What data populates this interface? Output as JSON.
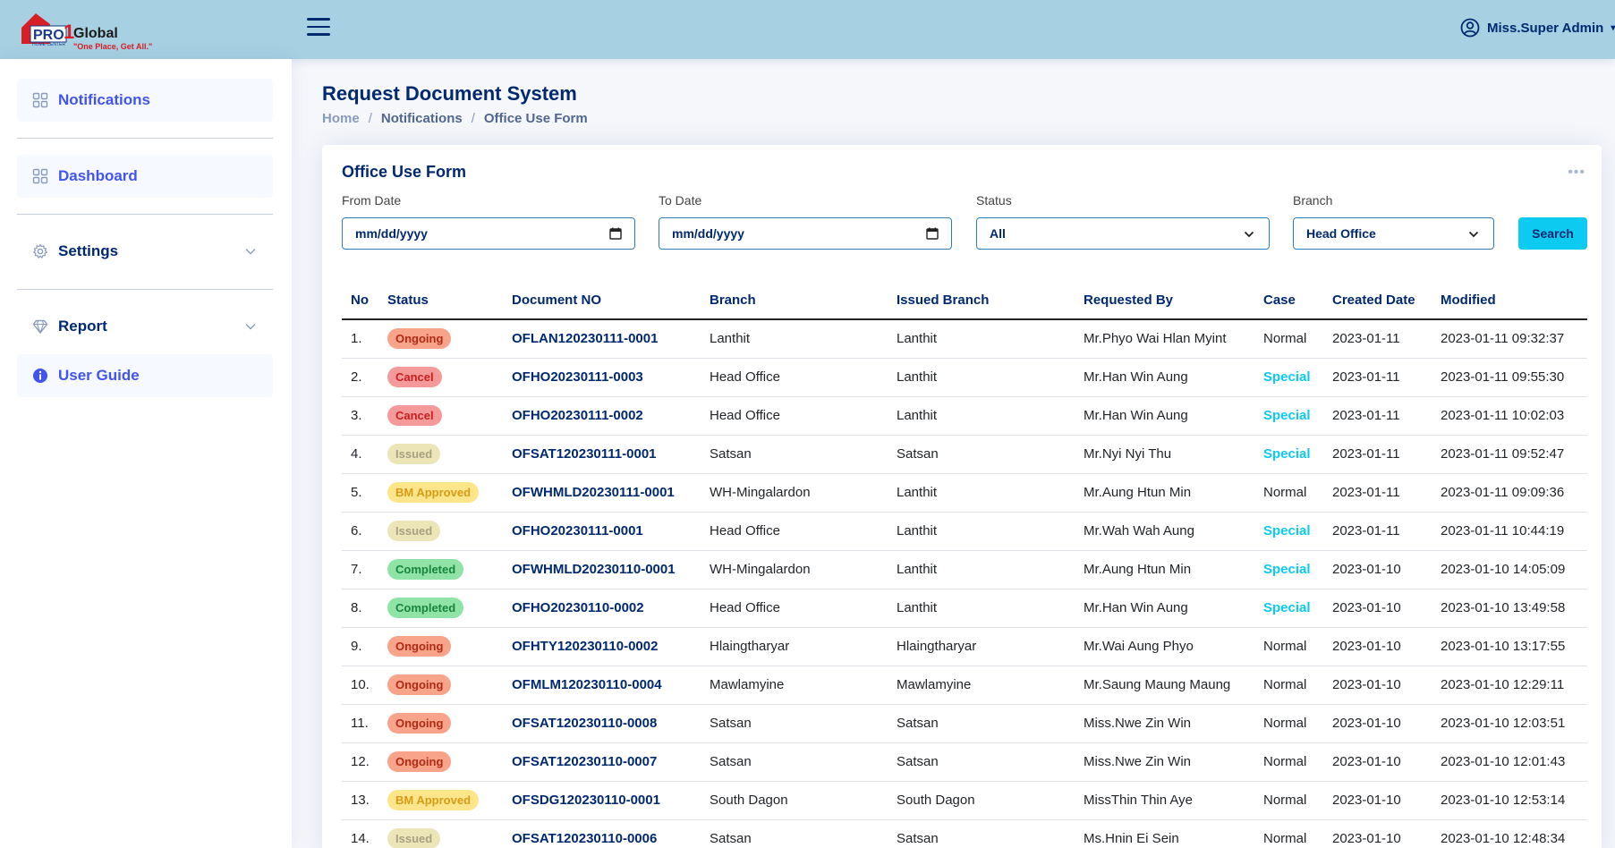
{
  "header": {
    "logo_text": "PRO1 Global",
    "logo_tagline": "\"One Place, Get All.\"",
    "logo_sub": "HOME CENTER",
    "user_name": "Miss.Super Admin"
  },
  "sidebar": {
    "items": [
      {
        "label": "Notifications",
        "icon": "grid-icon"
      },
      {
        "label": "Dashboard",
        "icon": "grid-icon"
      },
      {
        "label": "Settings",
        "icon": "gear-icon"
      },
      {
        "label": "Report",
        "icon": "gem-icon"
      },
      {
        "label": "User Guide",
        "icon": "info-icon"
      }
    ]
  },
  "page": {
    "title": "Request Document System",
    "breadcrumb": [
      "Home",
      "Notifications",
      "Office Use Form"
    ],
    "breadcrumb_sep": "/"
  },
  "card": {
    "title": "Office Use Form",
    "menu": "•••",
    "filters": {
      "from_label": "From Date",
      "from_value": "mm/dd/yyyy",
      "to_label": "To Date",
      "to_value": "mm/dd/yyyy",
      "status_label": "Status",
      "status_value": "All",
      "branch_label": "Branch",
      "branch_value": "Head Office",
      "search_label": "Search"
    },
    "columns": [
      "No",
      "Status",
      "Document NO",
      "Branch",
      "Issued Branch",
      "Requested By",
      "Case",
      "Created Date",
      "Modified"
    ],
    "rows": [
      [
        "1.",
        "Ongoing",
        "OFLAN120230111-0001",
        "Lanthit",
        "Lanthit",
        "Mr.Phyo Wai Hlan Myint",
        "Normal",
        "2023-01-11",
        "2023-01-11 09:32:37"
      ],
      [
        "2.",
        "Cancel",
        "OFHO20230111-0003",
        "Head Office",
        "Lanthit",
        "Mr.Han Win Aung",
        "Special",
        "2023-01-11",
        "2023-01-11 09:55:30"
      ],
      [
        "3.",
        "Cancel",
        "OFHO20230111-0002",
        "Head Office",
        "Lanthit",
        "Mr.Han Win Aung",
        "Special",
        "2023-01-11",
        "2023-01-11 10:02:03"
      ],
      [
        "4.",
        "Issued",
        "OFSAT120230111-0001",
        "Satsan",
        "Satsan",
        "Mr.Nyi Nyi Thu",
        "Special",
        "2023-01-11",
        "2023-01-11 09:52:47"
      ],
      [
        "5.",
        "BM Approved",
        "OFWHMLD20230111-0001",
        "WH-Mingalardon",
        "Lanthit",
        "Mr.Aung Htun Min",
        "Normal",
        "2023-01-11",
        "2023-01-11 09:09:36"
      ],
      [
        "6.",
        "Issued",
        "OFHO20230111-0001",
        "Head Office",
        "Lanthit",
        "Mr.Wah Wah Aung",
        "Special",
        "2023-01-11",
        "2023-01-11 10:44:19"
      ],
      [
        "7.",
        "Completed",
        "OFWHMLD20230110-0001",
        "WH-Mingalardon",
        "Lanthit",
        "Mr.Aung Htun Min",
        "Special",
        "2023-01-10",
        "2023-01-10 14:05:09"
      ],
      [
        "8.",
        "Completed",
        "OFHO20230110-0002",
        "Head Office",
        "Lanthit",
        "Mr.Han Win Aung",
        "Special",
        "2023-01-10",
        "2023-01-10 13:49:58"
      ],
      [
        "9.",
        "Ongoing",
        "OFHTY120230110-0002",
        "Hlaingtharyar",
        "Hlaingtharyar",
        "Mr.Wai Aung Phyo",
        "Normal",
        "2023-01-10",
        "2023-01-10 13:17:55"
      ],
      [
        "10.",
        "Ongoing",
        "OFMLM120230110-0004",
        "Mawlamyine",
        "Mawlamyine",
        "Mr.Saung Maung Maung",
        "Normal",
        "2023-01-10",
        "2023-01-10 12:29:11"
      ],
      [
        "11.",
        "Ongoing",
        "OFSAT120230110-0008",
        "Satsan",
        "Satsan",
        "Miss.Nwe Zin Win",
        "Normal",
        "2023-01-10",
        "2023-01-10 12:03:51"
      ],
      [
        "12.",
        "Ongoing",
        "OFSAT120230110-0007",
        "Satsan",
        "Satsan",
        "Miss.Nwe Zin Win",
        "Normal",
        "2023-01-10",
        "2023-01-10 12:01:43"
      ],
      [
        "13.",
        "BM Approved",
        "OFSDG120230110-0001",
        "South Dagon",
        "South Dagon",
        "MissThin Thin Aye",
        "Normal",
        "2023-01-10",
        "2023-01-10 12:53:14"
      ],
      [
        "14.",
        "Issued",
        "OFSAT120230110-0006",
        "Satsan",
        "Satsan",
        "Ms.Hnin Ei Sein",
        "Normal",
        "2023-01-10",
        "2023-01-10 12:48:34"
      ]
    ]
  }
}
